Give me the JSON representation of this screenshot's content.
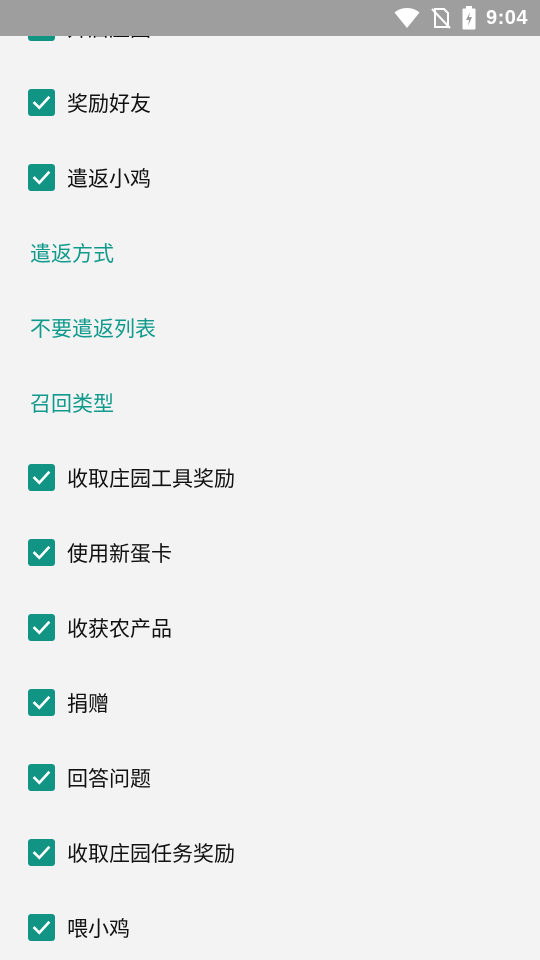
{
  "status_bar": {
    "time": "9:04",
    "icons": [
      "wifi-icon",
      "no-sim-icon",
      "battery-charging-icon"
    ]
  },
  "colors": {
    "accent": "#129484",
    "section_text": "#0f9a8c",
    "background": "#f3f3f3",
    "status_bar": "#9e9e9e"
  },
  "rows": [
    {
      "type": "checkbox",
      "label": "开启庄园",
      "checked": true,
      "partial": true
    },
    {
      "type": "checkbox",
      "label": "奖励好友",
      "checked": true
    },
    {
      "type": "checkbox",
      "label": "遣返小鸡",
      "checked": true
    },
    {
      "type": "section",
      "label": "遣返方式"
    },
    {
      "type": "section",
      "label": "不要遣返列表"
    },
    {
      "type": "section",
      "label": "召回类型"
    },
    {
      "type": "checkbox",
      "label": "收取庄园工具奖励",
      "checked": true
    },
    {
      "type": "checkbox",
      "label": "使用新蛋卡",
      "checked": true
    },
    {
      "type": "checkbox",
      "label": "收获农产品",
      "checked": true
    },
    {
      "type": "checkbox",
      "label": "捐赠",
      "checked": true
    },
    {
      "type": "checkbox",
      "label": "回答问题",
      "checked": true
    },
    {
      "type": "checkbox",
      "label": "收取庄园任务奖励",
      "checked": true
    },
    {
      "type": "checkbox",
      "label": "喂小鸡",
      "checked": true
    }
  ]
}
